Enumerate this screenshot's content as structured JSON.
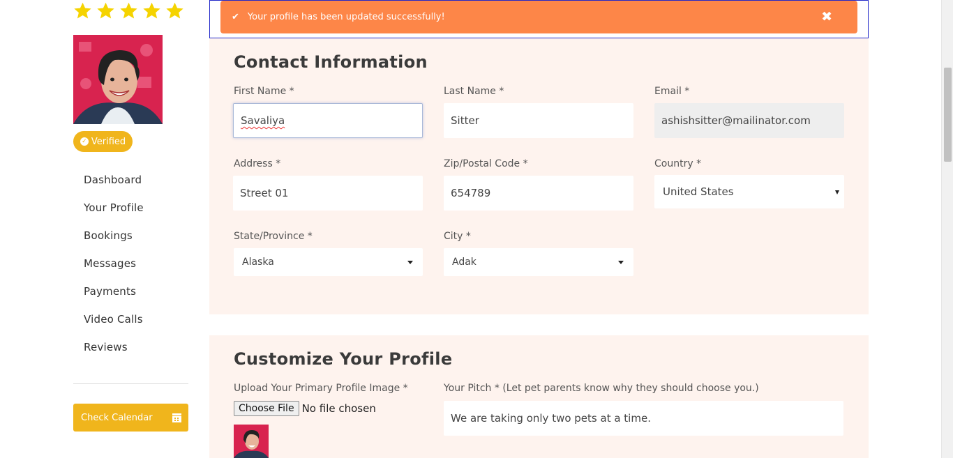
{
  "rating": {
    "stars": 5,
    "icon": "star-icon",
    "color": "#f5d300"
  },
  "profile": {
    "verified_label": "Verified",
    "verified_icon": "check-circle-icon"
  },
  "sidebar": {
    "items": [
      {
        "label": "Dashboard"
      },
      {
        "label": "Your Profile"
      },
      {
        "label": "Bookings"
      },
      {
        "label": "Messages"
      },
      {
        "label": "Payments"
      },
      {
        "label": "Video Calls"
      },
      {
        "label": "Reviews"
      }
    ],
    "calendar_button": {
      "label": "Check Calendar",
      "icon": "calendar-icon"
    }
  },
  "alert": {
    "message": "Your profile has been updated successfully!",
    "icon": "check-icon",
    "close": "✖",
    "color": "#fd8648"
  },
  "contact": {
    "title": "Contact Information",
    "first_name": {
      "label": "First Name *",
      "value": "Savaliya"
    },
    "last_name": {
      "label": "Last Name *",
      "value": "Sitter"
    },
    "email": {
      "label": "Email *",
      "value": "ashishsitter@mailinator.com"
    },
    "address": {
      "label": "Address *",
      "value": "Street 01"
    },
    "zip": {
      "label": "Zip/Postal Code *",
      "value": "654789"
    },
    "country": {
      "label": "Country *",
      "value": "United States"
    },
    "state": {
      "label": "State/Province *",
      "value": "Alaska"
    },
    "city": {
      "label": "City *",
      "value": "Adak"
    }
  },
  "customize": {
    "title": "Customize Your Profile",
    "image": {
      "label": "Upload Your Primary Profile Image *",
      "button": "Choose File",
      "status": "No file chosen"
    },
    "pitch": {
      "label": "Your Pitch * (Let pet parents know why they should choose you.)",
      "value": "We are taking only two pets at a time."
    }
  },
  "colors": {
    "accent": "#f0b51c",
    "panel_bg": "#fef3ee",
    "alert": "#fd8648"
  }
}
